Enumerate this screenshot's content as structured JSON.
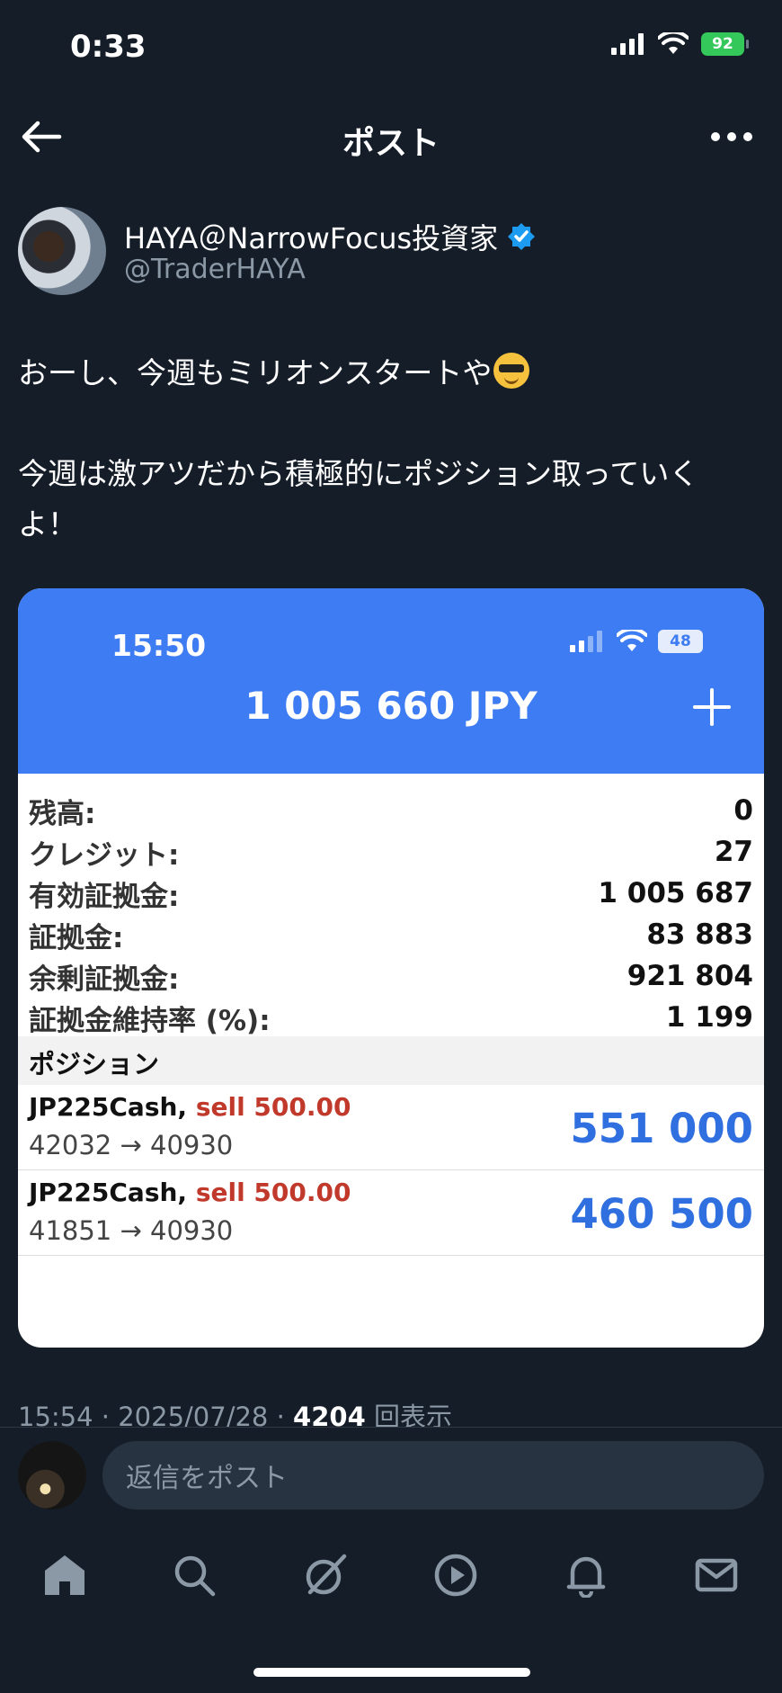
{
  "status_bar": {
    "time": "0:33",
    "battery": "92"
  },
  "header": {
    "title": "ポスト"
  },
  "author": {
    "name": "HAYA＠NarrowFocus投資家",
    "handle": "@TraderHAYA"
  },
  "tweet": {
    "line1": "おーし、今週もミリオンスタートや",
    "line2": "今週は激アツだから積極的にポジション取っていく",
    "line3": "よ！"
  },
  "embed": {
    "inner_time": "15:50",
    "inner_battery": "48",
    "equity_title": "1 005 660 JPY",
    "account_rows": [
      {
        "label": "残高:",
        "value": "0"
      },
      {
        "label": "クレジット:",
        "value": "27"
      },
      {
        "label": "有効証拠金:",
        "value": "1 005 687"
      },
      {
        "label": "証拠金:",
        "value": "83 883"
      },
      {
        "label": "余剰証拠金:",
        "value": "921 804"
      },
      {
        "label": "証拠金維持率 (%):",
        "value": "1 199"
      }
    ],
    "positions_label": "ポジション",
    "positions": [
      {
        "symbol": "JP225Cash,",
        "side": "sell 500.00",
        "prices": "42032 → 40930",
        "profit": "551 000"
      },
      {
        "symbol": "JP225Cash,",
        "side": "sell 500.00",
        "prices": "41851 → 40930",
        "profit": "460 500"
      }
    ]
  },
  "meta": {
    "time_date": "15:54 · 2025/07/28 · ",
    "views": "4204",
    "views_label": "回表示"
  },
  "reply": {
    "placeholder": "返信をポスト"
  },
  "nav": [
    "home-icon",
    "search-icon",
    "grok-icon",
    "video-icon",
    "notifications-icon",
    "messages-icon"
  ],
  "colors": {
    "accent": "#3d7cf2",
    "background": "#151d28",
    "verified": "#1d9bf0",
    "sell": "#c0392b"
  }
}
